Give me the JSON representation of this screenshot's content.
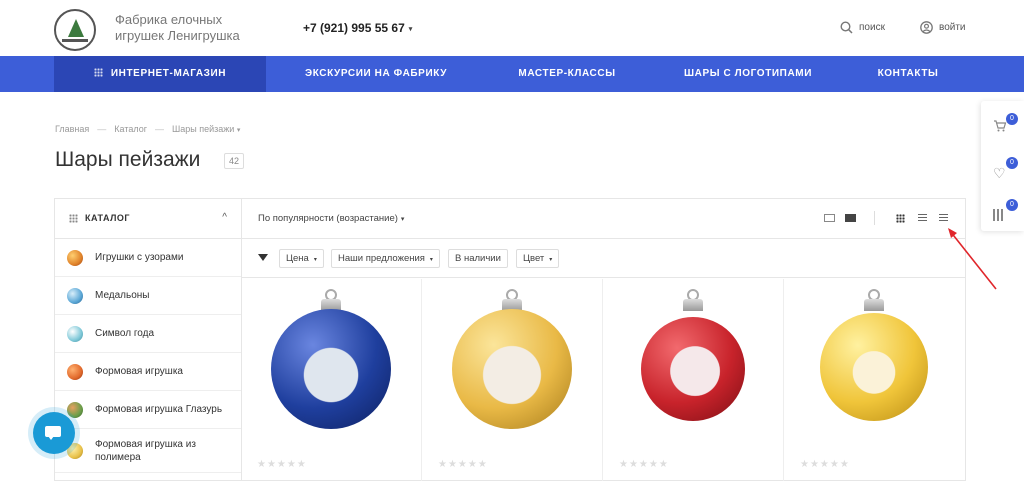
{
  "header": {
    "brand_line1": "Фабрика елочных",
    "brand_line2": "игрушек Ленигрушка",
    "phone": "+7 (921) 995 55 67",
    "search_label": "поиск",
    "login_label": "войти"
  },
  "nav": {
    "items": [
      {
        "label": "ИНТЕРНЕТ-МАГАЗИН"
      },
      {
        "label": "ЭКСКУРСИИ НА ФАБРИКУ"
      },
      {
        "label": "МАСТЕР-КЛАССЫ"
      },
      {
        "label": "ШАРЫ С ЛОГОТИПАМИ"
      },
      {
        "label": "КОНТАКТЫ"
      }
    ]
  },
  "breadcrumb": {
    "items": [
      "Главная",
      "Каталог",
      "Шары пейзажи"
    ],
    "separator": "—"
  },
  "page": {
    "title": "Шары пейзажи",
    "count": "42"
  },
  "sidebar": {
    "header": "КАТАЛОГ",
    "items": [
      {
        "label": "Игрушки с узорами",
        "color": "#e0832a"
      },
      {
        "label": "Медальоны",
        "color": "#5aa7d6"
      },
      {
        "label": "Символ года",
        "color": "#7ec8d8"
      },
      {
        "label": "Формовая игрушка",
        "color": "#e26a2c"
      },
      {
        "label": "Формовая игрушка Глазурь",
        "color": "#6b9e4a"
      },
      {
        "label": "Формовая игрушка из полимера",
        "color": "#e8c14a"
      }
    ]
  },
  "sortbar": {
    "sort_label": "По популярности (возрастание)"
  },
  "filters": [
    {
      "label": "Цена"
    },
    {
      "label": "Наши предложения"
    },
    {
      "label": "В наличии"
    },
    {
      "label": "Цвет"
    }
  ],
  "products": [
    {
      "ball_color": "#1f3f9e",
      "stars": "★★★★★"
    },
    {
      "ball_color": "#e9b946",
      "stars": "★★★★★"
    },
    {
      "ball_color": "#c8232b",
      "stars": "★★★★★"
    },
    {
      "ball_color": "#f0c53a",
      "stars": "★★★★★"
    }
  ],
  "float_panel": {
    "cart_count": "0",
    "favorites_count": "0",
    "compare_count": "0"
  },
  "colors": {
    "nav_bg": "#3d5ed8",
    "nav_active": "#2b46b5",
    "badge": "#3d5ed8",
    "chat": "#1a9ad6",
    "annotation": "#e0262b"
  }
}
